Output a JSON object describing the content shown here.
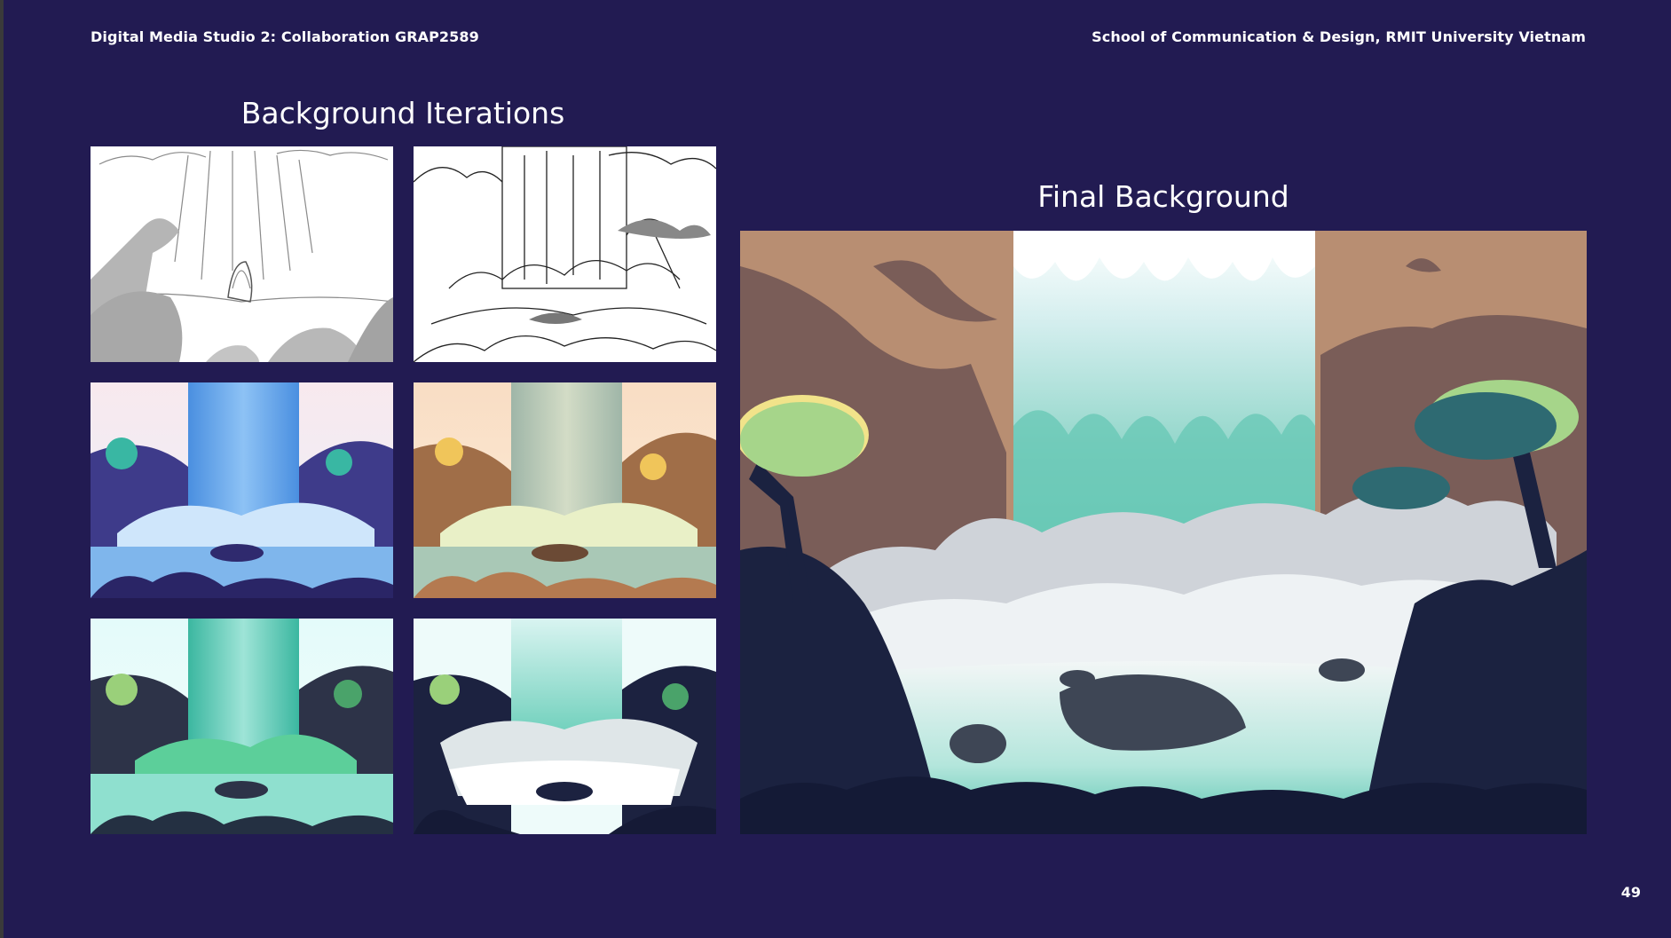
{
  "header": {
    "course": "Digital Media Studio 2: Collaboration GRAP2589",
    "school": "School of Communication & Design, RMIT University Vietnam"
  },
  "iterations": {
    "title": "Background Iterations",
    "thumbnails": [
      {
        "kind": "sketch-rough"
      },
      {
        "kind": "lineart"
      },
      {
        "kind": "color-blue"
      },
      {
        "kind": "color-earth"
      },
      {
        "kind": "color-teal"
      },
      {
        "kind": "color-dark-teal"
      }
    ]
  },
  "final": {
    "title": "Final Background"
  },
  "page_number": "49",
  "colors": {
    "background": "#221b52",
    "text": "#ffffff"
  }
}
